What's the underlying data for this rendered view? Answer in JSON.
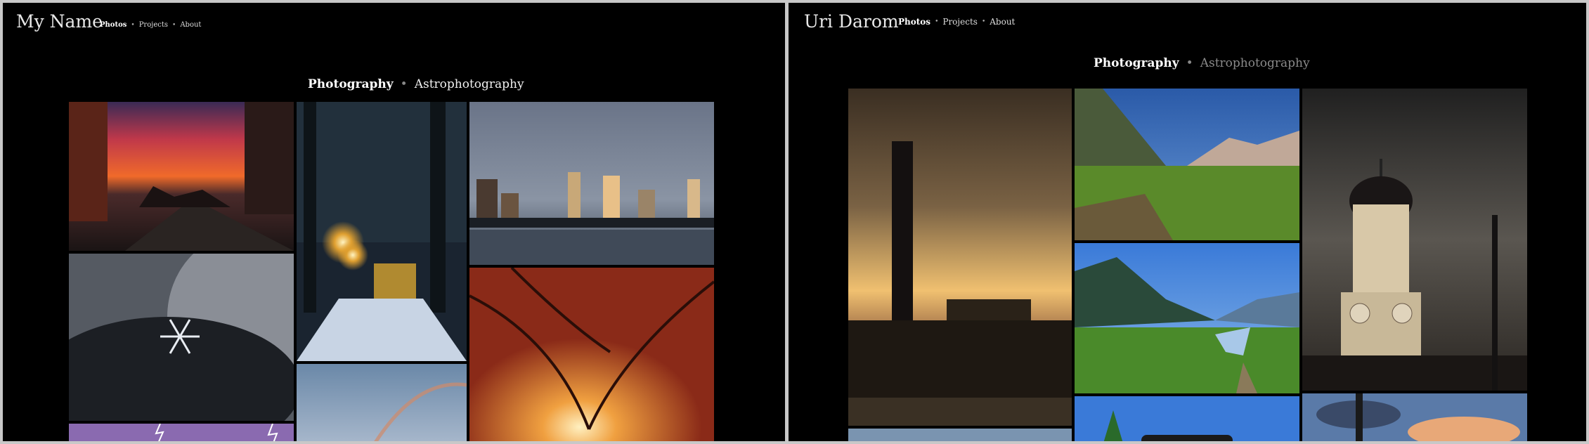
{
  "left": {
    "site_title": "My Name",
    "nav": [
      {
        "label": "Photos",
        "active": true
      },
      {
        "label": "Projects",
        "active": false
      },
      {
        "label": "About",
        "active": false
      }
    ],
    "separator": "•",
    "subnav": [
      {
        "label": "Photography",
        "active": true
      },
      {
        "label": "Astrophotography",
        "active": false
      }
    ]
  },
  "right": {
    "site_title": "Uri Darom",
    "nav": [
      {
        "label": "Photos",
        "active": true
      },
      {
        "label": "Projects",
        "active": false
      },
      {
        "label": "About",
        "active": false
      }
    ],
    "separator": "•",
    "subnav": [
      {
        "label": "Photography",
        "active": true
      },
      {
        "label": "Astrophotography",
        "active": false
      }
    ]
  }
}
